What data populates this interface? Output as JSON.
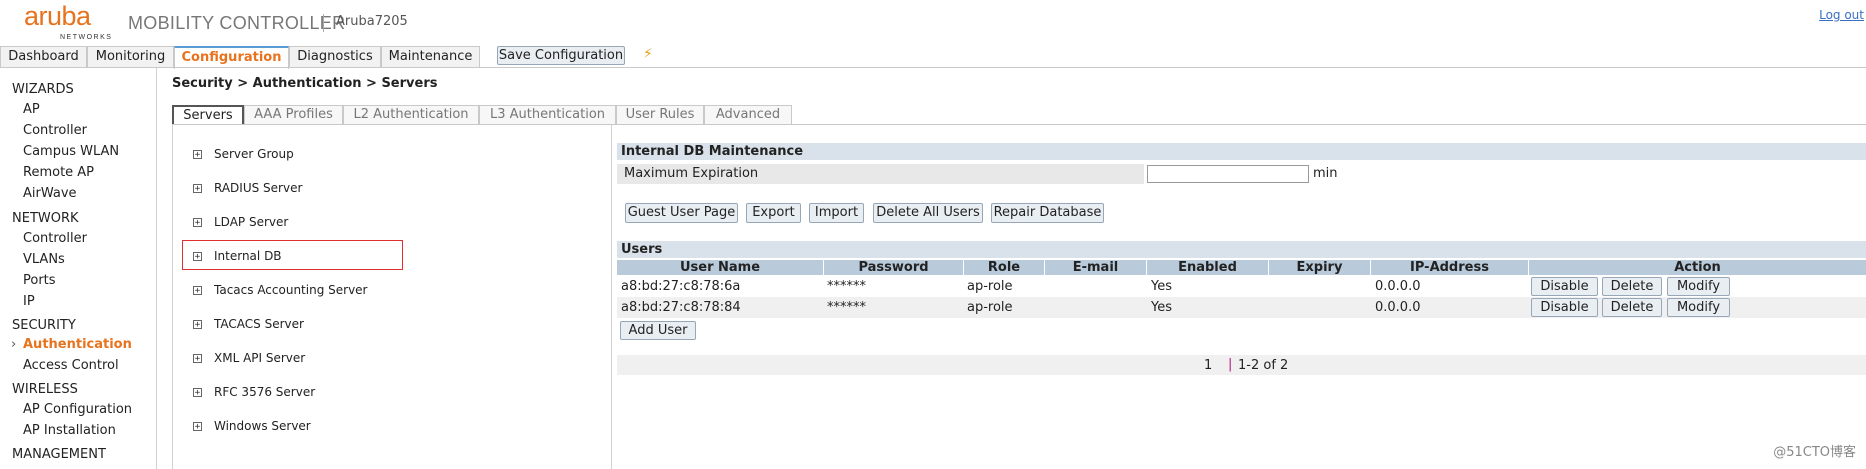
{
  "header": {
    "brand": "aruba",
    "brand_sub": "NETWORKS",
    "product": "MOBILITY CONTROLLER",
    "hostname": "Aruba7205",
    "logout": "Log out"
  },
  "main_tabs": [
    "Dashboard",
    "Monitoring",
    "Configuration",
    "Diagnostics",
    "Maintenance"
  ],
  "active_main_tab": "Configuration",
  "save_configuration": "Save Configuration",
  "sidebar": {
    "sections": [
      {
        "title": "WIZARDS",
        "items": [
          "AP",
          "Controller",
          "Campus WLAN",
          "Remote AP",
          "AirWave"
        ]
      },
      {
        "title": "NETWORK",
        "items": [
          "Controller",
          "VLANs",
          "Ports",
          "IP"
        ]
      },
      {
        "title": "SECURITY",
        "items": [
          "Authentication",
          "Access Control"
        ]
      },
      {
        "title": "WIRELESS",
        "items": [
          "AP Configuration",
          "AP Installation"
        ]
      },
      {
        "title": "MANAGEMENT",
        "items": []
      }
    ],
    "active_item": "Authentication"
  },
  "breadcrumb": "Security > Authentication > Servers",
  "sub_tabs": [
    "Servers",
    "AAA Profiles",
    "L2 Authentication",
    "L3 Authentication",
    "User Rules",
    "Advanced"
  ],
  "active_sub_tab": "Servers",
  "tree": [
    "Server Group",
    "RADIUS Server",
    "LDAP Server",
    "Internal DB",
    "Tacacs Accounting Server",
    "TACACS Server",
    "XML API Server",
    "RFC 3576 Server",
    "Windows Server"
  ],
  "selected_tree_item": "Internal DB",
  "internal_db": {
    "title": "Internal DB Maintenance",
    "max_expiration_label": "Maximum Expiration",
    "max_expiration_value": "",
    "max_expiration_unit": "min",
    "buttons": [
      "Guest User Page",
      "Export",
      "Import",
      "Delete All Users",
      "Repair Database"
    ]
  },
  "users": {
    "title": "Users",
    "columns": [
      "User Name",
      "Password",
      "Role",
      "E-mail",
      "Enabled",
      "Expiry",
      "IP-Address",
      "Action"
    ],
    "rows": [
      {
        "user_name": "a8:bd:27:c8:78:6a",
        "password": "******",
        "role": "ap-role",
        "email": "",
        "enabled": "Yes",
        "expiry": "",
        "ip": "0.0.0.0"
      },
      {
        "user_name": "a8:bd:27:c8:78:84",
        "password": "******",
        "role": "ap-role",
        "email": "",
        "enabled": "Yes",
        "expiry": "",
        "ip": "0.0.0.0"
      }
    ],
    "row_actions": [
      "Disable",
      "Delete",
      "Modify"
    ],
    "add_user": "Add User",
    "pager_page": "1",
    "pager_sep": "|",
    "pager_info": "1-2 of 2"
  },
  "watermark": "@51CTO博客",
  "colors": {
    "accent": "#e8731e",
    "table_header": "#b9cadb",
    "section_bar": "#d9e1ea",
    "highlight_box": "#e0302e"
  }
}
